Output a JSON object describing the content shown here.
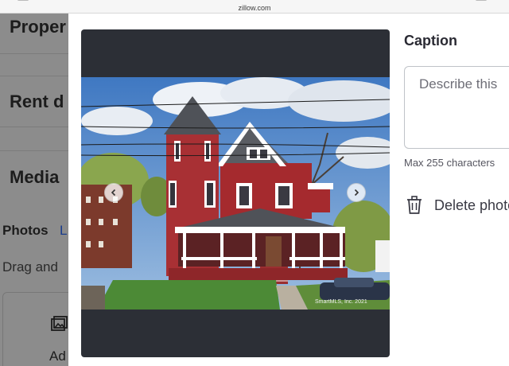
{
  "browser": {
    "url": "zillow.com"
  },
  "background_page": {
    "heading_1": "Proper",
    "heading_2": "Rent d",
    "heading_3": "Media",
    "photos_label": "Photos",
    "learn_link": "L",
    "drag_text": "Drag and",
    "upload_label": "Ad"
  },
  "viewer": {
    "watermark": "SmartMLS, Inc. 2021"
  },
  "caption": {
    "title": "Caption",
    "placeholder": "Describe this",
    "hint": "Max 255 characters"
  },
  "delete": {
    "label": "Delete photo"
  },
  "colors": {
    "accent_dark": "#2c2f36",
    "house_red": "#a52a2e",
    "sky": "#4f86c6"
  }
}
